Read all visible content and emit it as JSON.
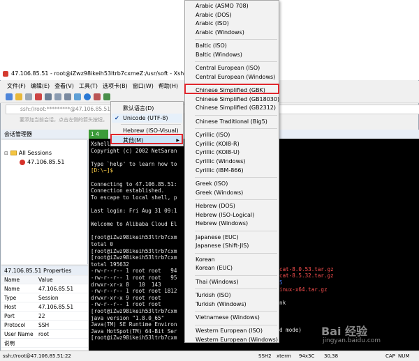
{
  "window": {
    "title": "47.106.85.51 - root@iZwz98ikeih53ltrb7cxmeZ:/usr/soft - Xshell 6 (Fr",
    "menu": [
      "文件(F)",
      "编辑(E)",
      "查看(V)",
      "工具(T)",
      "选项卡(B)",
      "窗口(W)",
      "帮助(H)"
    ],
    "address": "ssh://root:*********@47.106.85.51",
    "hint": "要添加当前会话，点击左侧的箭头按钮。"
  },
  "sessions": {
    "header": "会话管理器",
    "root": "All Sessions",
    "child": "47.106.85.51"
  },
  "properties": {
    "header": "47.106.85.51 Properties",
    "col_name": "Name",
    "col_value": "Value",
    "rows": [
      {
        "k": "Name",
        "v": "47.106.85.51"
      },
      {
        "k": "Type",
        "v": "Session"
      },
      {
        "k": "Host",
        "v": "47.106.85.51"
      },
      {
        "k": "Port",
        "v": "22"
      },
      {
        "k": "Protocol",
        "v": "SSH"
      },
      {
        "k": "User Name",
        "v": "root"
      },
      {
        "k": "说明",
        "v": ""
      }
    ]
  },
  "tab": {
    "label": "1 4"
  },
  "terminal": {
    "lines": [
      {
        "t": "Xshell",
        "c": "#ffffff"
      },
      {
        "t": "Copyright (c) 2002 NetSaran",
        "c": "#e6e6e6"
      },
      {
        "t": "",
        "c": "#e6e6e6"
      },
      {
        "t": "Type `help' to learn how to",
        "c": "#e6e6e6"
      },
      {
        "t": "[D:\\~]$",
        "c": "#ffd04a"
      },
      {
        "t": "",
        "c": "#e6e6e6"
      },
      {
        "t": "Connecting to 47.106.85.51:",
        "c": "#e6e6e6"
      },
      {
        "t": "Connection established.",
        "c": "#e6e6e6"
      },
      {
        "t": "To escape to local shell, p",
        "c": "#e6e6e6"
      },
      {
        "t": "",
        "c": "#e6e6e6"
      },
      {
        "t": "Last login: Fri Aug 31 09:1",
        "c": "#e6e6e6"
      },
      {
        "t": "",
        "c": "#e6e6e6"
      },
      {
        "t": "Welcome to Alibaba Cloud El",
        "c": "#e6e6e6"
      },
      {
        "t": "",
        "c": "#e6e6e6"
      },
      {
        "t": "[root@iZwz98ikeih53ltrb7cxm",
        "c": "#e6e6e6"
      },
      {
        "t": "total 0",
        "c": "#e6e6e6"
      },
      {
        "t": "[root@iZwz98ikeih53ltrb7cxm",
        "c": "#e6e6e6"
      },
      {
        "t": "[root@iZwz98ikeih53ltrb7cxm",
        "c": "#e6e6e6"
      },
      {
        "t": "total 195632",
        "c": "#e6e6e6"
      },
      {
        "t": "-rw-r--r-- 1 root root   94",
        "c": "#e6e6e6"
      },
      {
        "t": "-rw-r--r-- 1 root root   95",
        "c": "#e6e6e6"
      },
      {
        "t": "drwxr-xr-x 8   10  143",
        "c": "#e6e6e6"
      },
      {
        "t": "-rw-r--r-- 1 root root 1812",
        "c": "#e6e6e6"
      },
      {
        "t": "drwxr-xr-x 9 root root",
        "c": "#e6e6e6"
      },
      {
        "t": "-rw-r--r-- 1 root root",
        "c": "#e6e6e6"
      },
      {
        "t": "[root@iZwz98ikeih53ltrb7cxm",
        "c": "#e6e6e6"
      },
      {
        "t": "java version \"1.8.0_65\"",
        "c": "#e6e6e6"
      },
      {
        "t": "Java(TM) SE Runtime Environ",
        "c": "#e6e6e6"
      },
      {
        "t": "Java HotSpot(TM) 64-Bit Ser",
        "c": "#e6e6e6"
      },
      {
        "t": "[root@iZwz98ikeih53ltrb7cxm",
        "c": "#e6e6e6"
      }
    ],
    "right": [
      {
        "t": "eserved.",
        "c": "#e6e6e6"
      },
      {
        "t": "cat-8.0.53.tar.gz",
        "c": "#ff5050"
      },
      {
        "t": "cat-8.5.32.tar.gz",
        "c": "#ff5050"
      },
      {
        "t": "5",
        "c": "#4a7dff"
      },
      {
        "t": "inux-x64.tar.gz",
        "c": "#ff5050"
      },
      {
        "t": "nk",
        "c": "#e6e6e6"
      },
      {
        "t": "d mode)",
        "c": "#e6e6e6"
      }
    ]
  },
  "context_menu": {
    "items": [
      "默认语言(D)",
      "Unicode (UTF-8)",
      "Hebrew (ISO-Visual)",
      "其他(M)"
    ],
    "checked": "✔",
    "arrow": "▶"
  },
  "encodings": [
    "Arabic (ASMO 708)",
    "Arabic (DOS)",
    "Arabic (ISO)",
    "Arabic (Windows)",
    "Baltic (ISO)",
    "Baltic (Windows)",
    "Central European (ISO)",
    "Central European (Windows)",
    "Chinese Simplified (GBK)",
    "Chinese Simplified (GB18030)",
    "Chinese Simplified (GB2312)",
    "Chinese Traditional (Big5)",
    "Cyrillic (ISO)",
    "Cyrillic (KOI8-R)",
    "Cyrillic (KOI8-U)",
    "Cyrillic (Windows)",
    "Cyrillic (IBM-866)",
    "Greek (ISO)",
    "Greek (Windows)",
    "Hebrew (DOS)",
    "Hebrew (ISO-Logical)",
    "Hebrew (Windows)",
    "Japanese (EUC)",
    "Japanese (Shift-JIS)",
    "Korean",
    "Korean (EUC)",
    "Thai (Windows)",
    "Turkish (ISO)",
    "Turkish (Windows)",
    "Vietnamese (Windows)",
    "Western European (ISO)",
    "Western European (Windows)"
  ],
  "status": {
    "path": "ssh://root@47.106.85.51:22",
    "proto": "SSH2",
    "term": "xterm",
    "size": "94x3C",
    "pos": "30,38",
    "cap": "CAP",
    "num": "NUM"
  },
  "watermark": {
    "main": "Bai 经验",
    "url": "jingyan.baidu.com"
  },
  "colors": {
    "highlight": "#e0262c",
    "selected_bg": "#cce4f7",
    "terminal_bg": "#000000"
  }
}
